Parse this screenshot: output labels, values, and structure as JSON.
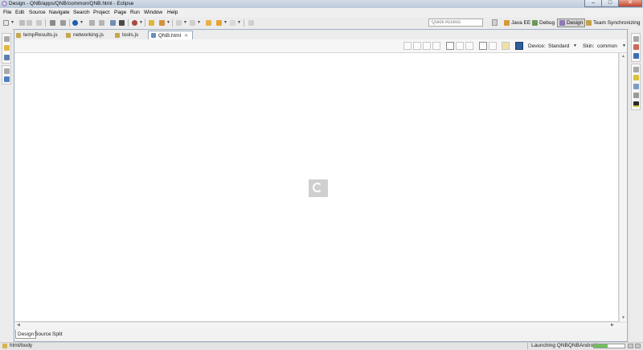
{
  "window": {
    "title": "Design - QNB/apps/QNB/common/QNB.html - Eclipse",
    "minimize_glyph": "–",
    "maximize_glyph": "□",
    "close_glyph": "✕"
  },
  "menu": [
    "File",
    "Edit",
    "Source",
    "Navigate",
    "Search",
    "Project",
    "Page",
    "Run",
    "Window",
    "Help"
  ],
  "quick_access": {
    "placeholder": "Quick Access"
  },
  "perspectives": [
    {
      "label": "Java EE",
      "icon": "java-ee-perspective-icon",
      "active": false
    },
    {
      "label": "Debug",
      "icon": "debug-perspective-icon",
      "active": false
    },
    {
      "label": "Design",
      "icon": "design-perspective-icon",
      "active": true
    },
    {
      "label": "Team Synchronizing",
      "icon": "team-sync-perspective-icon",
      "active": false
    }
  ],
  "editor_tabs": [
    {
      "label": "tempResults.js",
      "active": false
    },
    {
      "label": "networking.js",
      "active": false
    },
    {
      "label": "tools.js",
      "active": false
    },
    {
      "label": "QNB.html",
      "active": true
    }
  ],
  "design_toolbar": {
    "device_label": "Device:",
    "device_value": "Standard",
    "skin_label": "Skin:",
    "skin_value": "common"
  },
  "view_modes": [
    {
      "label": "Design",
      "active": true
    },
    {
      "label": "Source",
      "active": false
    },
    {
      "label": "Split",
      "active": false
    }
  ],
  "status": {
    "path": "html/body",
    "progress_text": "Launching QNBQNBAndroid",
    "progress_fraction": 0.45
  },
  "colors": {
    "accent": "#6fbf5b",
    "editor_border": "#9fb0c4",
    "spinner_bg": "#cfcfcf"
  }
}
